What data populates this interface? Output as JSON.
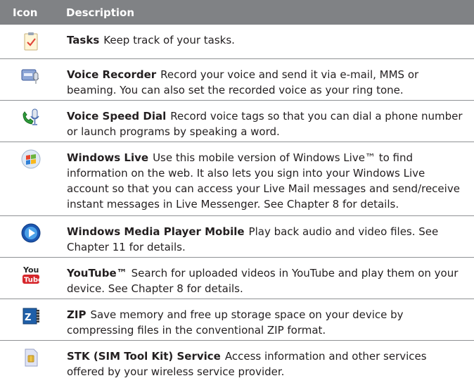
{
  "header": {
    "icon_col": "Icon",
    "desc_col": "Description"
  },
  "rows": [
    {
      "icon": "tasks-icon",
      "name": "Tasks",
      "desc": "Keep track of your tasks."
    },
    {
      "icon": "voice-recorder-icon",
      "name": "Voice Recorder",
      "desc": "Record your voice and send it via e-mail, MMS or beaming. You can also set the recorded voice as your ring tone."
    },
    {
      "icon": "voice-speed-dial-icon",
      "name": "Voice Speed Dial",
      "desc": "Record voice tags so that you can dial a phone number or launch programs by speaking a word."
    },
    {
      "icon": "windows-live-icon",
      "name": "Windows Live",
      "desc": "Use this mobile version of Windows Live™ to find information on the web. It also lets you sign into your Windows Live account so that you can access your Live Mail messages and send/receive instant messages in Live Messenger. See Chapter 8 for details."
    },
    {
      "icon": "windows-media-player-icon",
      "name": "Windows Media Player Mobile",
      "desc": "Play back audio and video files. See Chapter 11 for details."
    },
    {
      "icon": "youtube-icon",
      "name": "YouTube™",
      "desc": "Search for uploaded videos in YouTube and play them on your device. See Chapter 8 for details."
    },
    {
      "icon": "zip-icon",
      "name": "ZIP",
      "desc": "Save memory and free up storage space on your device by compressing files in the conventional ZIP format."
    },
    {
      "icon": "stk-service-icon",
      "name": "STK (SIM Tool Kit) Service",
      "desc": "Access information and other services offered by your wireless service provider."
    }
  ],
  "colors": {
    "header_bg": "#808285",
    "rule": "#8f9194",
    "text": "#231f20"
  }
}
